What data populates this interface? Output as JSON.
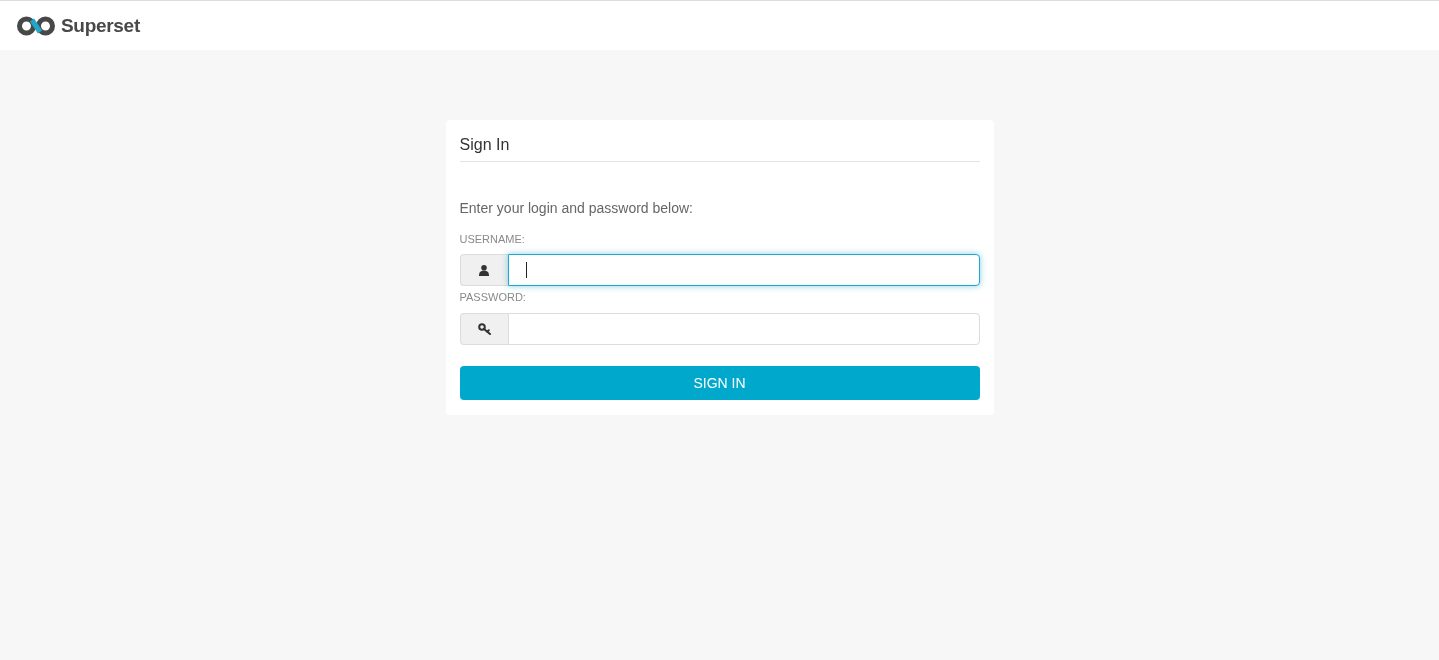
{
  "header": {
    "logo_text": "Superset"
  },
  "login_card": {
    "title": "Sign In",
    "instructions": "Enter your login and password below:",
    "fields": [
      {
        "kind": "username",
        "label": "USERNAME:",
        "focused": true
      },
      {
        "kind": "password",
        "label": "PASSWORD:",
        "focused": false
      }
    ],
    "submit_button": "SIGN IN"
  }
}
